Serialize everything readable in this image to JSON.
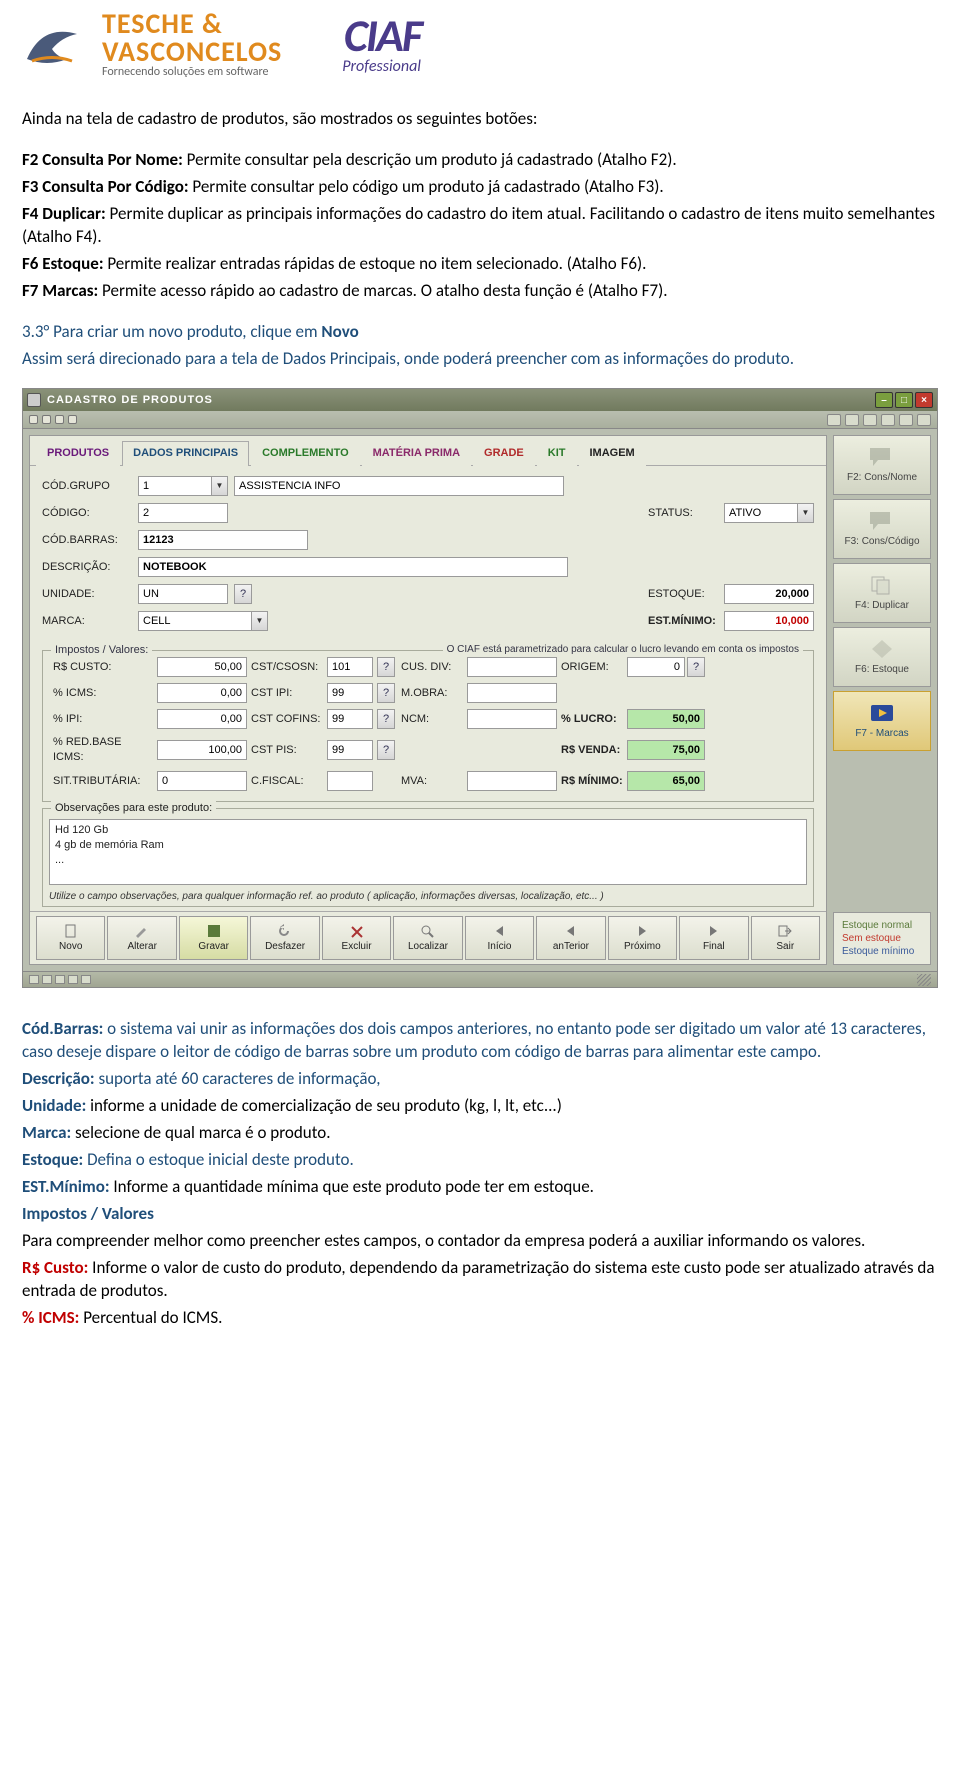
{
  "logos": {
    "tv_main": "TESCHE &",
    "tv_main2": "VASCONCELOS",
    "tv_sub": "Fornecendo soluções em software",
    "ciaf_main": "CIAF",
    "ciaf_sub": "Professional"
  },
  "doc": {
    "intro": "Ainda na tela de cadastro de produtos, são mostrados os seguintes botões:",
    "f2_t": "F2 Consulta Por Nome:",
    "f2": " Permite consultar pela descrição um produto já cadastrado (Atalho F2).",
    "f3_t": "F3 Consulta Por Código:",
    "f3": " Permite consultar pelo código um produto já cadastrado (Atalho F3).",
    "f4_t": "F4 Duplicar:",
    "f4": " Permite duplicar as principais informações do cadastro do item atual. Facilitando o cadastro de itens muito semelhantes (Atalho  F4).",
    "f6_t": "F6 Estoque:",
    "f6": " Permite realizar entradas rápidas de estoque no item selecionado. (Atalho F6).",
    "f7_t": "F7 Marcas:",
    "f7": " Permite acesso rápido ao cadastro de marcas. O atalho desta função é (Atalho F7).",
    "s33a": "3.3° Para criar um novo produto, clique em ",
    "s33b": "Novo",
    "s33c": "Assim será direcionado para a tela de Dados Principais, onde poderá preencher com as informações do produto.",
    "cb_t": "Cód.Barras:",
    "cb": " o sistema vai unir as informações dos dois campos anteriores, no entanto pode ser digitado um valor até 13 caracteres, caso deseje dispare o leitor de código de barras sobre um produto com código de barras para alimentar este campo.",
    "desc_t": "Descrição:",
    "desc": " suporta até 60 caracteres de informação,",
    "uni_t": "Unidade: ",
    "uni": " informe a unidade de comercialização de seu produto (kg, l, lt, etc...)",
    "marca_t": "Marca: ",
    "marca": " selecione de qual marca é o produto.",
    "est_t": "Estoque:",
    "est": " Defina o estoque inicial deste produto.",
    "estmin_t": "EST.Mínimo:",
    "estmin": " Informe a quantidade mínima que este produto pode ter em estoque.",
    "iv_t": "Impostos / Valores",
    "iv": "Para compreender melhor como preencher estes campos, o contador da empresa poderá a auxiliar informando os valores.",
    "rsc_t": "R$ Custo:",
    "rsc": " Informe o valor de custo do produto, dependendo da parametrização do sistema este custo pode ser atualizado através da entrada de produtos.",
    "icms_t": "% ICMS:",
    "icms": " Percentual do ICMS."
  },
  "app": {
    "title": "CADASTRO DE PRODUTOS",
    "tabs": {
      "produtos": "PRODUTOS",
      "dados": "DADOS PRINCIPAIS",
      "complemento": "COMPLEMENTO",
      "materia": "MATÉRIA PRIMA",
      "grade": "GRADE",
      "kit": "KIT",
      "imagem": "IMAGEM"
    },
    "labels": {
      "codgrupo": "CÓD.GRUPO",
      "codigo": "CÓDIGO:",
      "codbarras": "CÓD.BARRAS:",
      "descricao": "DESCRIÇÃO:",
      "unidade": "UNIDADE:",
      "marca": "MARCA:",
      "status": "STATUS:",
      "estoque": "ESTOQUE:",
      "estminimo": "EST.MÍNIMO:",
      "fs_impostos": "Impostos / Valores:",
      "fs_hint": "O CIAF está parametrizado para calcular o lucro levando em conta os impostos",
      "rscusto": "R$ CUSTO:",
      "picms": "% ICMS:",
      "pipi": "% IPI:",
      "predbase": "% RED.BASE ICMS:",
      "sittrib": "SIT.TRIBUTÁRIA:",
      "cstcsosn": "CST/CSOSN:",
      "cstipi": "CST IPI:",
      "cstcofins": "CST COFINS:",
      "cstpis": "CST PIS:",
      "cfiscal": "C.FISCAL:",
      "cusdiv": "CUS. DIV:",
      "mobra": "M.OBRA:",
      "ncm": "NCM:",
      "mva": "MVA:",
      "origem": "ORIGEM:",
      "plucro": "% LUCRO:",
      "rsvenda": "R$ VENDA:",
      "rsminimo": "R$ MÍNIMO:",
      "obs": "Observações para este produto:",
      "obs_hint": "Utilize o campo observações, para qualquer informação ref. ao produto ( aplicação, informações diversas, localização, etc... )"
    },
    "values": {
      "codgrupo": "1",
      "grupo_nome": "ASSISTENCIA INFO",
      "codigo": "2",
      "status": "ATIVO",
      "codbarras": "12123",
      "descricao": "NOTEBOOK",
      "unidade": "UN",
      "estoque": "20,000",
      "marca": "CELL",
      "estminimo": "10,000",
      "rscusto": "50,00",
      "cstcsosn": "101",
      "cusdiv": "",
      "origem": "0",
      "picms": "0,00",
      "cstipi": "99",
      "mobra": "",
      "pipi": "0,00",
      "cstcofins": "99",
      "ncm": "",
      "plucro": "50,00",
      "predbase": "100,00",
      "cstpis": "99",
      "rsvenda": "75,00",
      "sittrib": "0",
      "cfiscal": "",
      "mva": "",
      "rsminimo": "65,00",
      "obs_text": "Hd 120 Gb\n4 gb de memória Ram\n..."
    },
    "actions": {
      "novo": "Novo",
      "alterar": "Alterar",
      "gravar": "Gravar",
      "desfazer": "Desfazer",
      "excluir": "Excluir",
      "localizar": "Localizar",
      "inicio": "Início",
      "anterior": "anTerior",
      "proximo": "Próximo",
      "final": "Final",
      "sair": "Sair"
    },
    "side": {
      "f2": "F2: Cons/Nome",
      "f3": "F3: Cons/Código",
      "f4": "F4: Duplicar",
      "f6": "F6: Estoque",
      "f7": "F7 - Marcas"
    },
    "legend": {
      "normal": "Estoque normal",
      "sem": "Sem estoque",
      "min": "Estoque mínimo"
    }
  }
}
